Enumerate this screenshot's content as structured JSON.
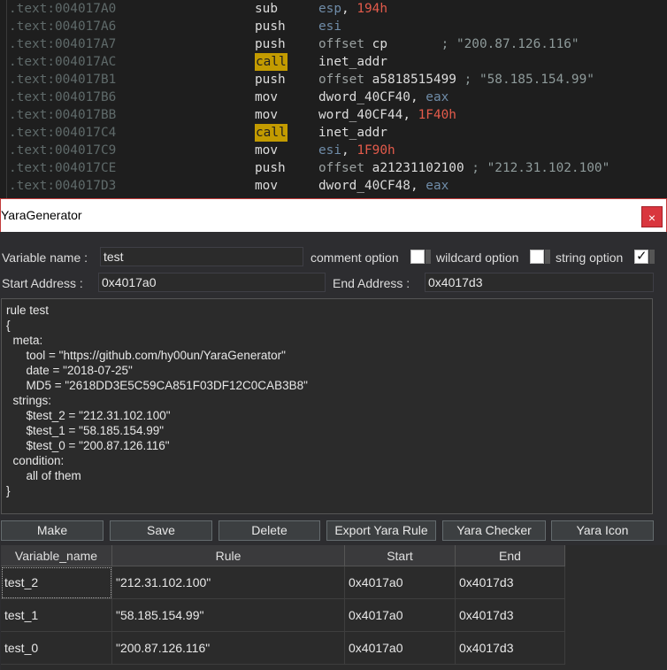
{
  "disasm": [
    {
      "addr": ".text:004017A0",
      "mnemonic": "sub",
      "highlight": false,
      "ops": [
        {
          "t": "esp",
          "k": "reg"
        },
        {
          "t": ", ",
          "k": "name"
        },
        {
          "t": "194h",
          "k": "imm"
        }
      ]
    },
    {
      "addr": ".text:004017A6",
      "mnemonic": "push",
      "highlight": false,
      "ops": [
        {
          "t": "esi",
          "k": "reg"
        }
      ]
    },
    {
      "addr": ".text:004017A7",
      "mnemonic": "push",
      "highlight": false,
      "ops": [
        {
          "t": "offset ",
          "k": "kw"
        },
        {
          "t": "cp",
          "k": "name"
        },
        {
          "t": "       ; \"200.87.126.116\"",
          "k": "cmt"
        }
      ]
    },
    {
      "addr": ".text:004017AC",
      "mnemonic": "call",
      "highlight": true,
      "ops": [
        {
          "t": "inet_addr",
          "k": "name"
        }
      ]
    },
    {
      "addr": ".text:004017B1",
      "mnemonic": "push",
      "highlight": false,
      "ops": [
        {
          "t": "offset ",
          "k": "kw"
        },
        {
          "t": "a5818515499",
          "k": "name"
        },
        {
          "t": " ; \"58.185.154.99\"",
          "k": "cmt"
        }
      ]
    },
    {
      "addr": ".text:004017B6",
      "mnemonic": "mov",
      "highlight": false,
      "ops": [
        {
          "t": "dword_40CF40",
          "k": "name"
        },
        {
          "t": ", ",
          "k": "name"
        },
        {
          "t": "eax",
          "k": "reg"
        }
      ]
    },
    {
      "addr": ".text:004017BB",
      "mnemonic": "mov",
      "highlight": false,
      "ops": [
        {
          "t": "word_40CF44",
          "k": "name"
        },
        {
          "t": ", ",
          "k": "name"
        },
        {
          "t": "1F40h",
          "k": "imm"
        }
      ]
    },
    {
      "addr": ".text:004017C4",
      "mnemonic": "call",
      "highlight": true,
      "ops": [
        {
          "t": "inet_addr",
          "k": "name"
        }
      ]
    },
    {
      "addr": ".text:004017C9",
      "mnemonic": "mov",
      "highlight": false,
      "ops": [
        {
          "t": "esi",
          "k": "reg"
        },
        {
          "t": ", ",
          "k": "name"
        },
        {
          "t": "1F90h",
          "k": "imm"
        }
      ]
    },
    {
      "addr": ".text:004017CE",
      "mnemonic": "push",
      "highlight": false,
      "ops": [
        {
          "t": "offset ",
          "k": "kw"
        },
        {
          "t": "a21231102100",
          "k": "name"
        },
        {
          "t": " ; \"212.31.102.100\"",
          "k": "cmt"
        }
      ]
    },
    {
      "addr": ".text:004017D3",
      "mnemonic": "mov",
      "highlight": false,
      "ops": [
        {
          "t": "dword_40CF48",
          "k": "name"
        },
        {
          "t": ", ",
          "k": "name"
        },
        {
          "t": "eax",
          "k": "reg"
        }
      ]
    }
  ],
  "window": {
    "title": "YaraGenerator",
    "close_glyph": "×"
  },
  "form": {
    "variable_label": "Variable name :",
    "variable_value": "test",
    "comment_label": "comment option",
    "comment_checked": false,
    "wildcard_label": "wildcard option",
    "wildcard_checked": false,
    "string_label": "string option",
    "string_checked": true,
    "start_label": "Start Address :",
    "start_value": "0x4017a0",
    "end_label": "End Address :",
    "end_value": "0x4017d3"
  },
  "rule_text": "rule test\n{\n  meta:\n      tool = \"https://github.com/hy00un/YaraGenerator\"\n      date = \"2018-07-25\"\n      MD5 = \"2618DD3E5C59CA851F03DF12C0CAB3B8\"\n  strings:\n      $test_2 = \"212.31.102.100\"\n      $test_1 = \"58.185.154.99\"\n      $test_0 = \"200.87.126.116\"\n  condition:\n      all of them\n}",
  "buttons": {
    "make": "Make",
    "save": "Save",
    "delete": "Delete",
    "export": "Export Yara Rule",
    "checker": "Yara Checker",
    "icon": "Yara Icon"
  },
  "table": {
    "headers": [
      "Variable_name",
      "Rule",
      "Start",
      "End"
    ],
    "rows": [
      {
        "name": "test_2",
        "rule": "\"212.31.102.100\"",
        "start": "0x4017a0",
        "end": "0x4017d3"
      },
      {
        "name": "test_1",
        "rule": "\"58.185.154.99\"",
        "start": "0x4017a0",
        "end": "0x4017d3"
      },
      {
        "name": "test_0",
        "rule": "\"200.87.126.116\"",
        "start": "0x4017a0",
        "end": "0x4017d3"
      }
    ]
  },
  "colors": {
    "accent_border": "#c23b3b",
    "call_highlight": "#c39b00",
    "immediate": "#e45b4b",
    "register": "#6f8ca8"
  }
}
